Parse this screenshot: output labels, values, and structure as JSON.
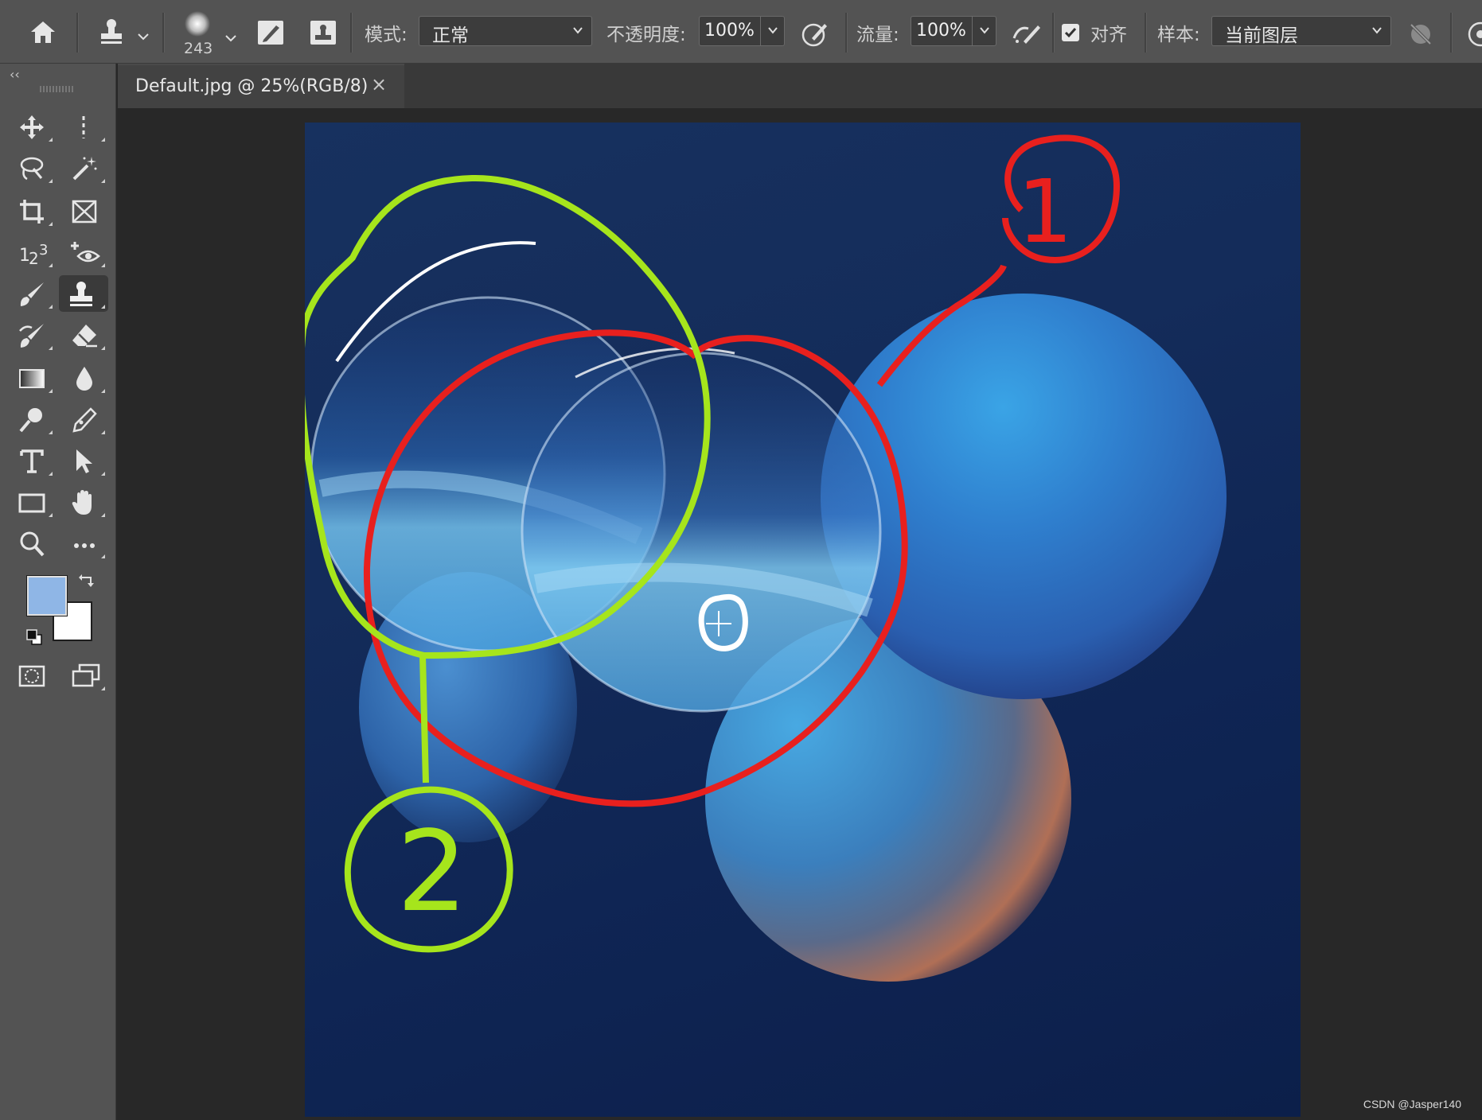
{
  "options_bar": {
    "brush_size": "243",
    "mode_label": "模式:",
    "mode_value": "正常",
    "opacity_label": "不透明度:",
    "opacity_value": "100%",
    "flow_label": "流量:",
    "flow_value": "100%",
    "aligned_label": "对齐",
    "aligned_checked": true,
    "sample_label": "样本:",
    "sample_value": "当前图层"
  },
  "document": {
    "tab_title": "Default.jpg @ 25%(RGB/8)",
    "close_glyph": "×"
  },
  "annotations": {
    "label_1": "1",
    "label_2": "2",
    "label_0": "0",
    "colors": {
      "red": "#e8201e",
      "green": "#a6e51c",
      "white": "#ffffff"
    }
  },
  "toolbar": {
    "collapse_glyph": "‹‹",
    "tools": [
      "move-tool",
      "rectangular-marquee-tool",
      "lasso-tool",
      "magic-wand-tool",
      "crop-tool",
      "frame-tool",
      "count-tool",
      "red-eye-tool",
      "brush-tool",
      "clone-stamp-tool",
      "history-brush-tool",
      "eraser-tool",
      "gradient-tool",
      "blur-tool",
      "dodge-tool",
      "pen-tool",
      "type-tool",
      "path-selection-tool",
      "rectangle-tool",
      "hand-tool",
      "zoom-tool",
      "more-tools"
    ],
    "active_tool": "clone-stamp-tool",
    "foreground_color": "#8fb6e6",
    "background_color": "#ffffff"
  },
  "watermark": "CSDN @Jasper140"
}
